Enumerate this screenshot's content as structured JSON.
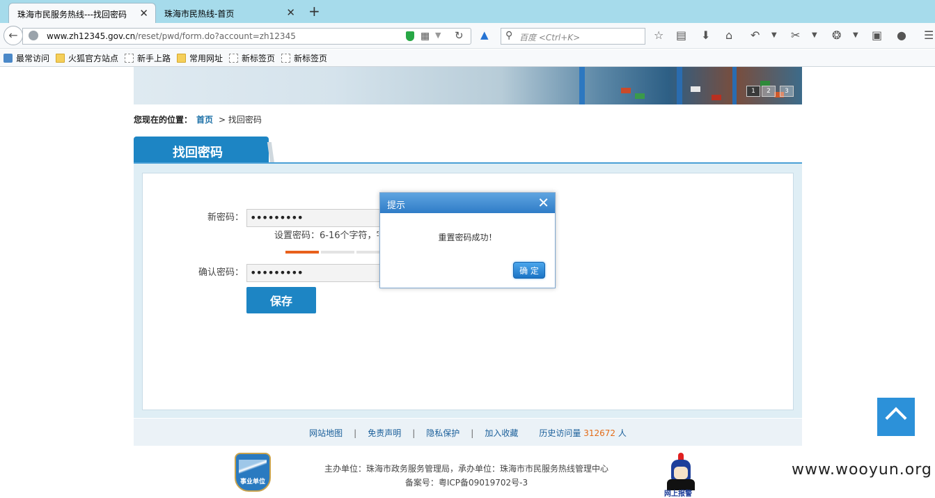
{
  "browser": {
    "tabs": [
      {
        "title": "珠海市民服务热线---找回密码",
        "close": "✕"
      },
      {
        "title": "珠海市民热线-首页",
        "close": "✕"
      }
    ],
    "new_tab": "+",
    "url_host": "www.zh12345.gov.cn",
    "url_path": "/reset/pwd/form.do?account=zh12345",
    "search_placeholder": "百度 <Ctrl+K>",
    "bookmarks": [
      "最常访问",
      "火狐官方站点",
      "新手上路",
      "常用网址",
      "新标签页",
      "新标签页"
    ]
  },
  "banner": {
    "pager": [
      "1",
      "2",
      "3"
    ]
  },
  "breadcrumb": {
    "label": "您现在的位置：",
    "home": "首页",
    "current": "> 找回密码"
  },
  "section_title": "找回密码",
  "form": {
    "new_password_label": "新密码：",
    "new_password_value": "•••••••••",
    "hint": "设置密码：6-16个字符，字",
    "confirm_label": "确认密码：",
    "confirm_value": "•••••••••",
    "save": "保存"
  },
  "dialog": {
    "title": "提示",
    "close": "✕",
    "message": "重置密码成功！",
    "ok": "确 定"
  },
  "footer": {
    "links": [
      "网站地图",
      "免责声明",
      "隐私保护",
      "加入收藏"
    ],
    "visits_label": "历史访问量",
    "visits_count": "312672",
    "visits_unit": "人",
    "sponsor": "主办单位：珠海市政务服务管理局，承办单位：珠海市市民服务热线管理中心",
    "icp": "备案号：粤ICP备09019702号-3",
    "badge_left": "事业单位",
    "badge_right": "网上报警"
  },
  "watermark": "www.wooyun.org",
  "colors": {
    "primary": "#1d85c4",
    "accent": "#e36b17",
    "tabbar": "#a6dbeb"
  }
}
